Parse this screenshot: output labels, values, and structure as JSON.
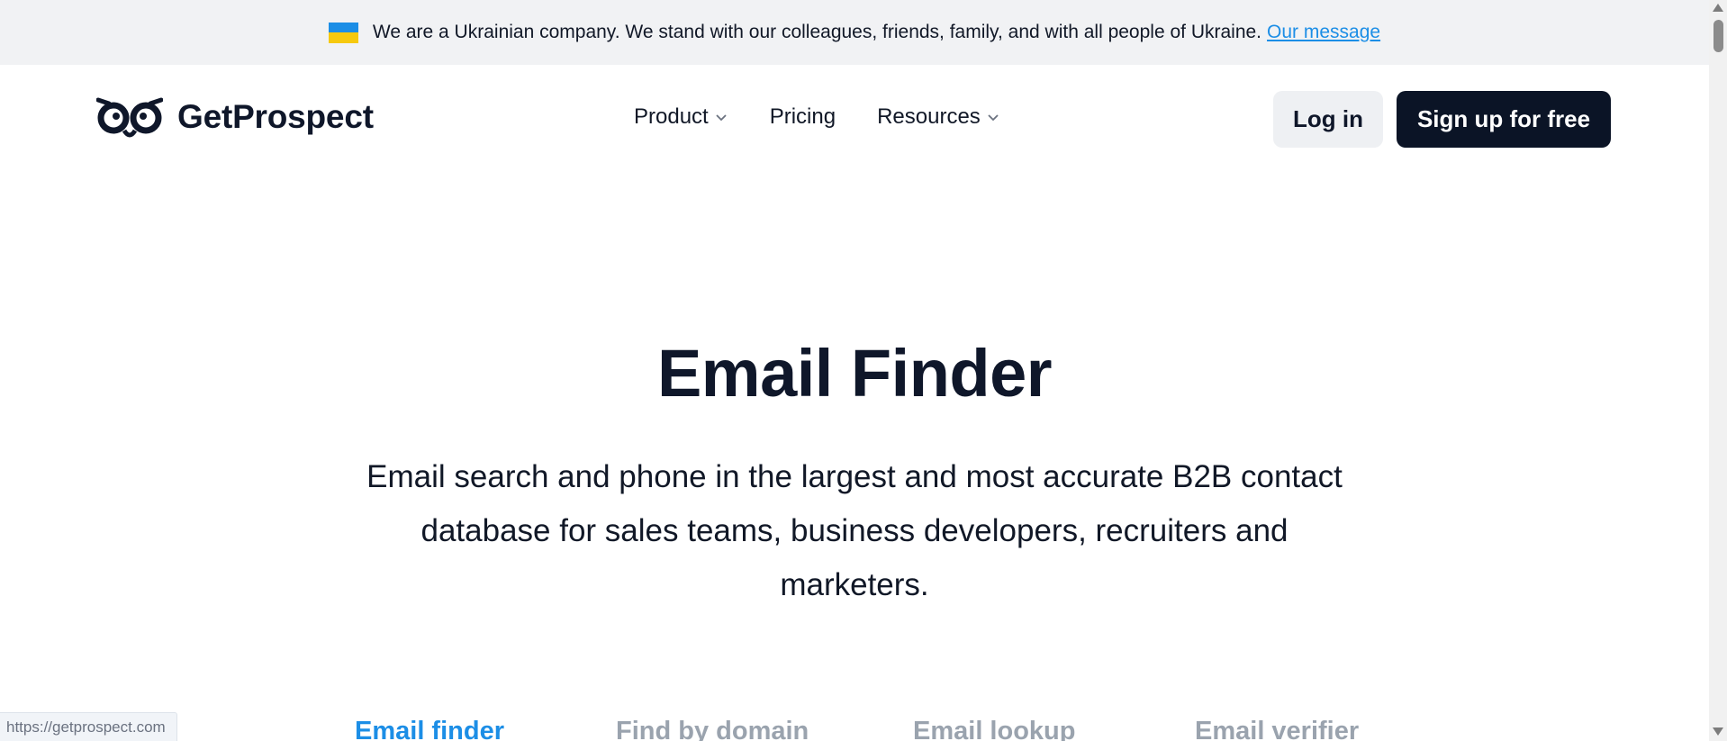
{
  "banner": {
    "message": "We are a Ukrainian company. We stand with our colleagues, friends, family, and with all people of Ukraine.",
    "link_text": "Our message",
    "flag_colors": [
      "#1c8ee6",
      "#f6c90e"
    ]
  },
  "header": {
    "brand": "GetProspect",
    "nav": [
      {
        "label": "Product",
        "has_dropdown": true
      },
      {
        "label": "Pricing",
        "has_dropdown": false
      },
      {
        "label": "Resources",
        "has_dropdown": true
      }
    ],
    "login_label": "Log in",
    "signup_label": "Sign up for free"
  },
  "hero": {
    "title": "Email Finder",
    "subtitle": "Email search and phone in the largest and most accurate B2B contact database for sales teams, business developers, recruiters and marketers."
  },
  "tabs": [
    {
      "label": "Email finder",
      "active": true
    },
    {
      "label": "Find by domain",
      "active": false
    },
    {
      "label": "Email lookup",
      "active": false
    },
    {
      "label": "Email verifier",
      "active": false
    }
  ],
  "status_bar": {
    "url": "https://getprospect.com"
  },
  "colors": {
    "accent": "#1c8ee6",
    "dark": "#0b1426",
    "banner_bg": "#f1f2f4"
  }
}
